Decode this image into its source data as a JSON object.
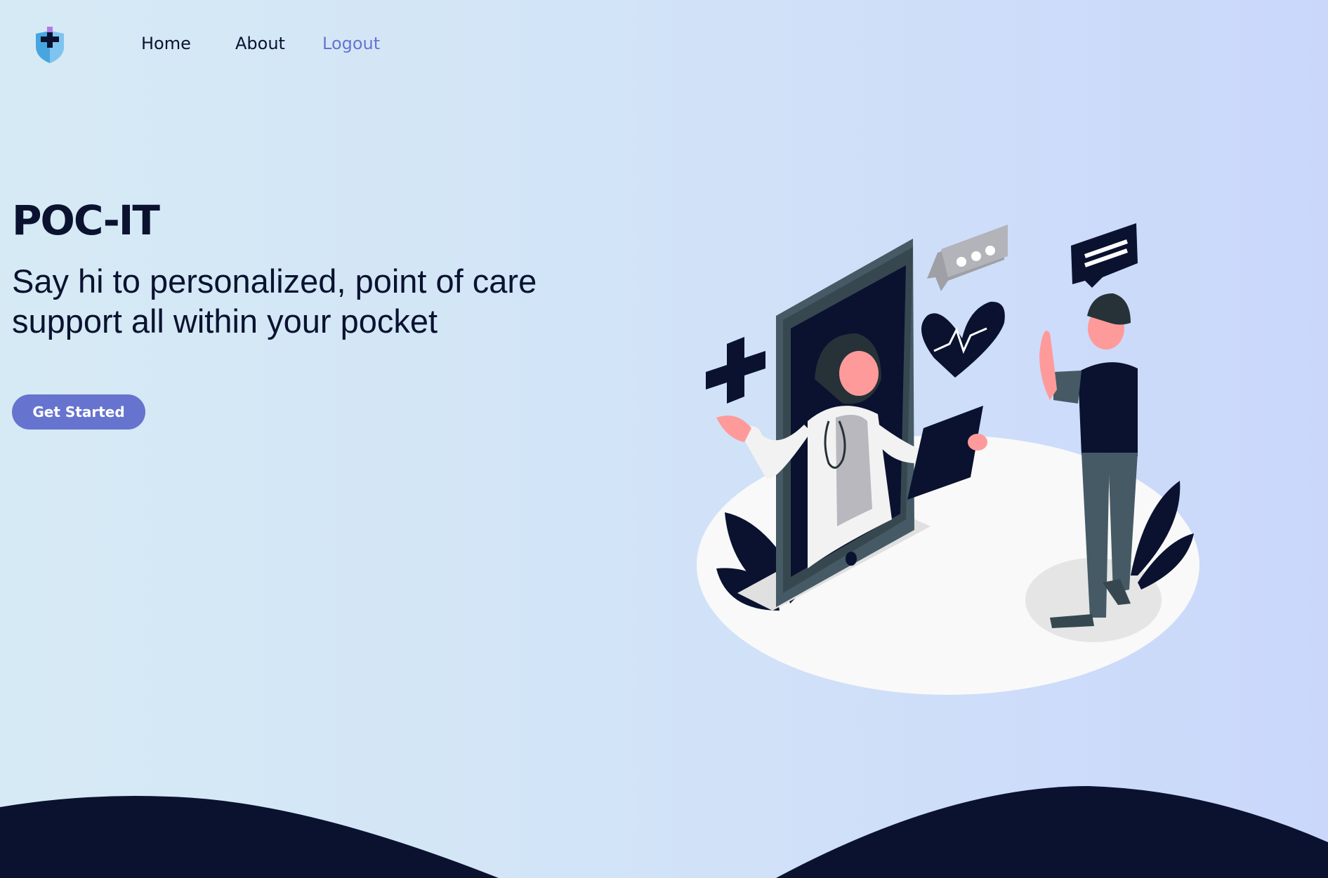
{
  "nav": {
    "logo_icon": "shield-plus-icon",
    "links": [
      {
        "label": "Home"
      },
      {
        "label": "About"
      },
      {
        "label": "Logout"
      }
    ]
  },
  "hero": {
    "title": "POC-IT",
    "subtitle": "Say hi to personalized, point of care support all within your pocket",
    "cta_label": "Get Started"
  },
  "colors": {
    "accent": "#6674cf",
    "dark": "#0a1230",
    "bg_left": "#d6eaf5",
    "bg_right": "#cad7fb"
  }
}
